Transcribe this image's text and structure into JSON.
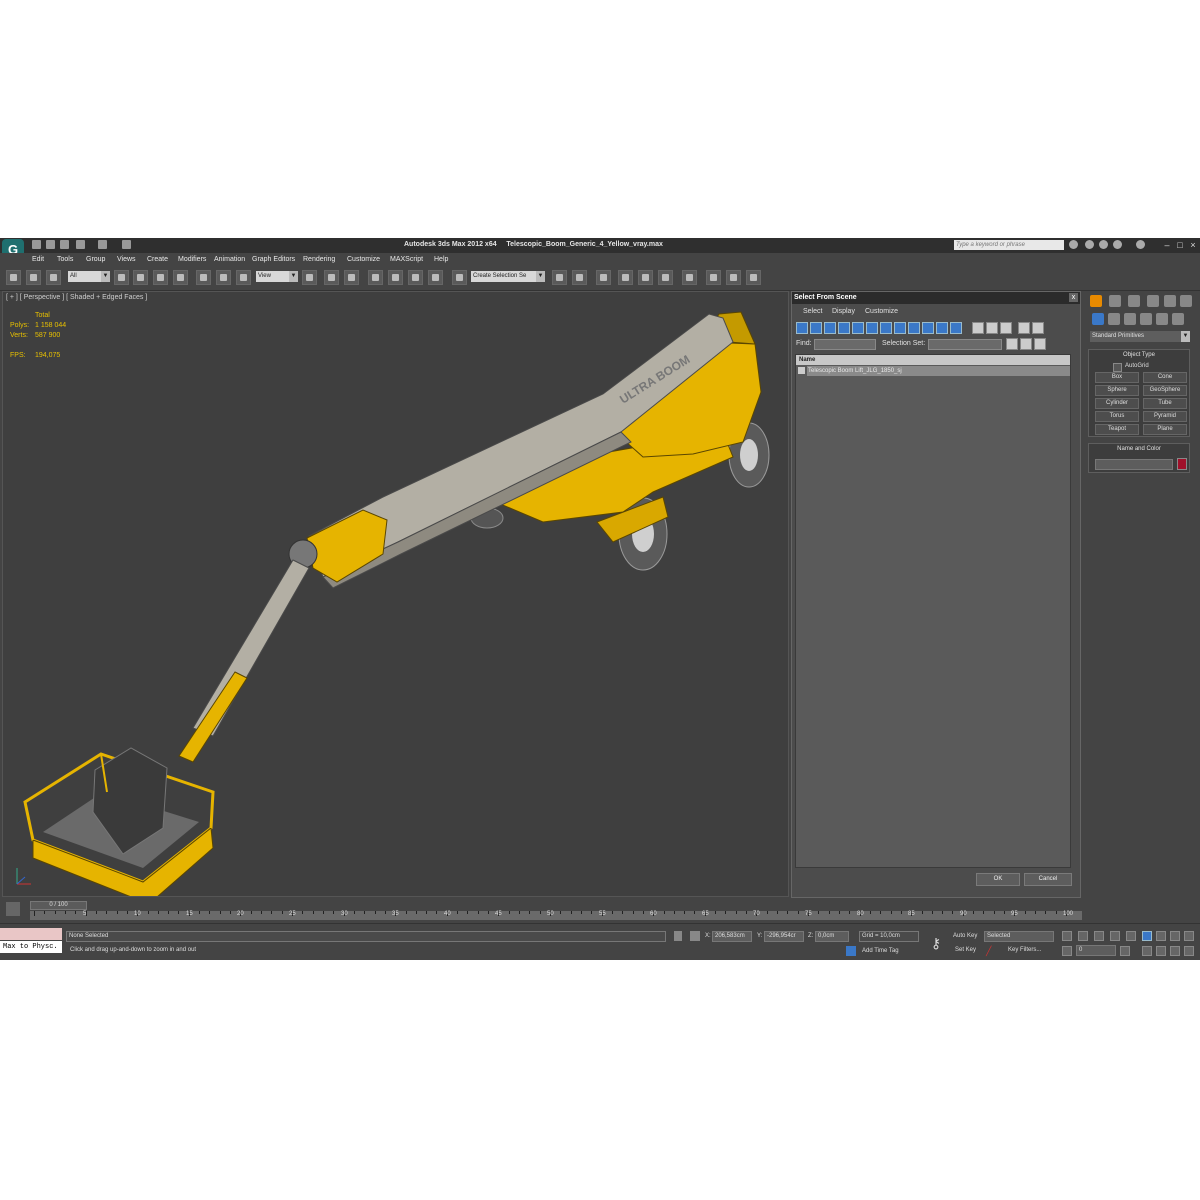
{
  "title": {
    "app": "Autodesk 3ds Max  2012 x64",
    "file": "Telescopic_Boom_Generic_4_Yellow_vray.max",
    "search_placeholder": "Type a keyword or phrase"
  },
  "menu": [
    "Edit",
    "Tools",
    "Group",
    "Views",
    "Create",
    "Modifiers",
    "Animation",
    "Graph Editors",
    "Rendering",
    "Customize",
    "MAXScript",
    "Help"
  ],
  "toolbar": {
    "filter_value": "All",
    "refcoord_value": "View",
    "selection_set_placeholder": "Create Selection Se"
  },
  "viewport": {
    "label": "[ + ] [ Perspective ] [ Shaded + Edged Faces ]",
    "stats": {
      "total_label": "Total",
      "polys_label": "Polys:",
      "polys_value": "1 158 044",
      "verts_label": "Verts:",
      "verts_value": "587 900",
      "fps_label": "FPS:",
      "fps_value": "194,075"
    },
    "model_text": "ULTRA BOOM",
    "accent_color": "#e6b400"
  },
  "select_dialog": {
    "title": "Select From Scene",
    "close": "x",
    "menu": [
      "Select",
      "Display",
      "Customize"
    ],
    "find_label": "Find:",
    "selection_set_label": "Selection Set:",
    "column_name": "Name",
    "items": [
      "Telescopic Boom Lift_JLG_1850_sj"
    ],
    "ok_label": "OK",
    "cancel_label": "Cancel"
  },
  "command_panel": {
    "category": "Standard Primitives",
    "object_type_title": "Object Type",
    "autogrid_label": "AutoGrid",
    "primitives": [
      "Box",
      "Cone",
      "Sphere",
      "GeoSphere",
      "Cylinder",
      "Tube",
      "Torus",
      "Pyramid",
      "Teapot",
      "Plane"
    ],
    "name_color_title": "Name and Color",
    "object_color": "#a0102a"
  },
  "timeline": {
    "slider_label": "0 / 100",
    "ticks": [
      "5",
      "10",
      "15",
      "20",
      "25",
      "30",
      "35",
      "40",
      "45",
      "50",
      "55",
      "60",
      "65",
      "70",
      "75",
      "80",
      "85",
      "90",
      "95",
      "100"
    ]
  },
  "status": {
    "maxscript_listener": "Max to Physc.",
    "selection": "None Selected",
    "prompt": "Click and drag up-and-down to zoom in and out",
    "x_label": "X:",
    "x_value": "206,583cm",
    "y_label": "Y:",
    "y_value": "-296,954cr",
    "z_label": "Z:",
    "z_value": "0,0cm",
    "grid": "Grid = 10,0cm",
    "add_time_tag": "Add Time Tag",
    "auto_key": "Auto Key",
    "set_key": "Set Key",
    "key_mode_value": "Selected",
    "key_filters": "Key Filters...",
    "frame_value": "0"
  }
}
